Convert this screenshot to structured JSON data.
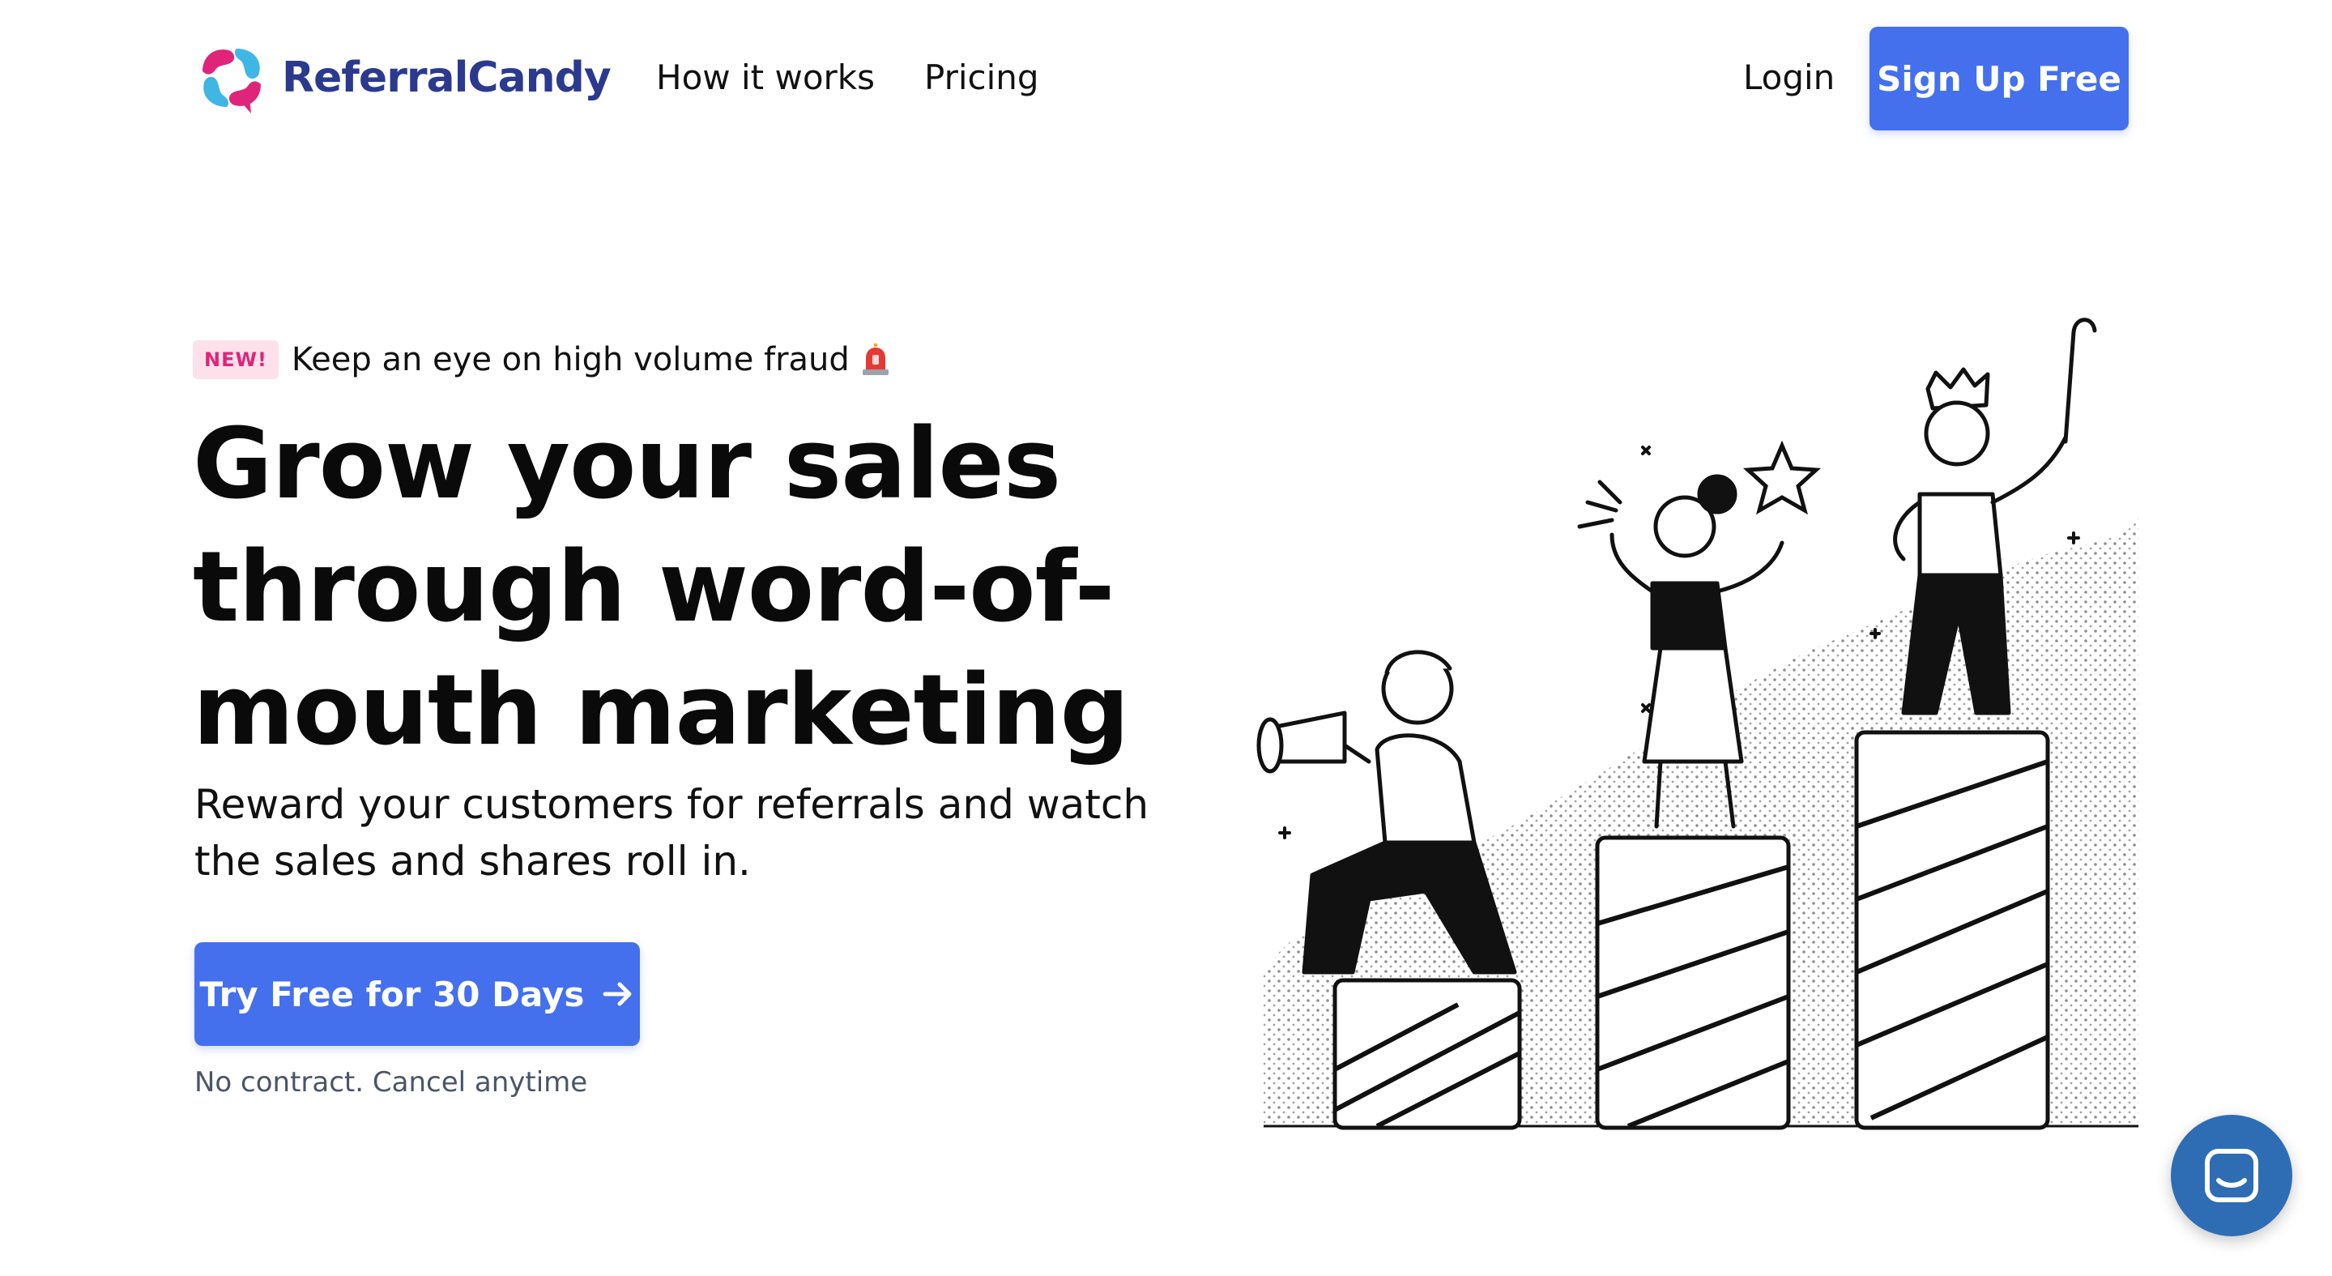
{
  "header": {
    "brand": "ReferralCandy",
    "nav": {
      "how_it_works": "How it works",
      "pricing": "Pricing",
      "login": "Login"
    },
    "signup_label": "Sign Up Free"
  },
  "announcement": {
    "badge": "NEW!",
    "text": "Keep an eye on high volume fraud",
    "icon": "siren-icon"
  },
  "hero": {
    "headline_lines": [
      "Grow your sales",
      "through word-of-",
      "mouth marketing"
    ],
    "subhead_lines": [
      "Reward your customers for referrals and watch",
      "the sales and shares roll in."
    ],
    "cta_label": "Try Free for 30 Days",
    "cta_icon": "arrow-right-icon",
    "fine_print": "No contract. Cancel anytime"
  },
  "chat": {
    "icon": "chat-bubble-icon"
  },
  "colors": {
    "primary_button": "#4470ee",
    "brand_text": "#2b3a8f",
    "brand_pink": "#e0247a",
    "brand_blue": "#3fb6e6",
    "badge_bg": "#fde1ea",
    "chat_launcher": "#2e6db4"
  }
}
